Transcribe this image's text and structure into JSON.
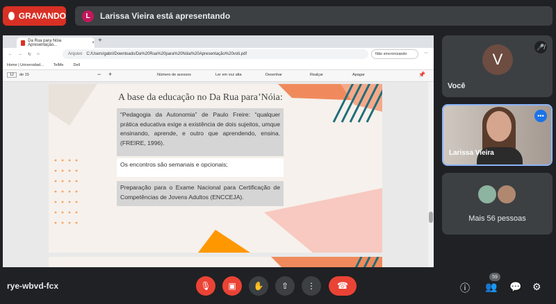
{
  "recording": {
    "label": "GRAVANDO"
  },
  "presenter": {
    "initial": "L",
    "text": "Larissa Vieira está apresentando"
  },
  "browser": {
    "tab_title": "Da Rua para Nóia Apresentação...",
    "tab_close": "×",
    "tab_add": "+",
    "address_prefix": "Arquivo",
    "url": "C:/Users/gabri/Downloads/Da%20Rua%20para%20Nóia%20Apresentação%20voti.pdf",
    "sync": "Não sincronizando",
    "bookmarks": [
      "Home | Universidad...",
      "TelMe",
      "Dell"
    ]
  },
  "pdf_toolbar": {
    "page": "12",
    "page_total": "de 15",
    "access": "Número de acessos",
    "read_aloud": "Ler em voz alta",
    "draw": "Desenhar",
    "highlight": "Realçar",
    "erase": "Apagar"
  },
  "slide": {
    "title": "A base da educação no Da Rua para’Nóia:",
    "box1": "“Pedagogia da Autonomia” de Paulo Freire: “qualquer prática educativa exige a existência de dois sujeitos, umque ensinando, aprende, e outro que aprendendo, ensina. (FREIRE, 1996).",
    "box2": "Os encontros são semanais e opcionais;",
    "box3": "Preparação para o Exame Nacional para Certificação de Competências de Jovens Adultos (ENCCEJA)."
  },
  "participants": {
    "self": {
      "initial": "V",
      "name": "Você"
    },
    "larissa": {
      "name": "Larissa Vieira"
    },
    "more": {
      "text": "Mais 56 pessoas"
    }
  },
  "meeting": {
    "code": "rye-wbvd-fcx",
    "people_count": "59"
  },
  "colors": {
    "background": "#202124",
    "tile": "#3c4043",
    "red": "#ea4335",
    "slide_orange": "#f08a5d",
    "slide_teal": "#1f6e7a"
  }
}
